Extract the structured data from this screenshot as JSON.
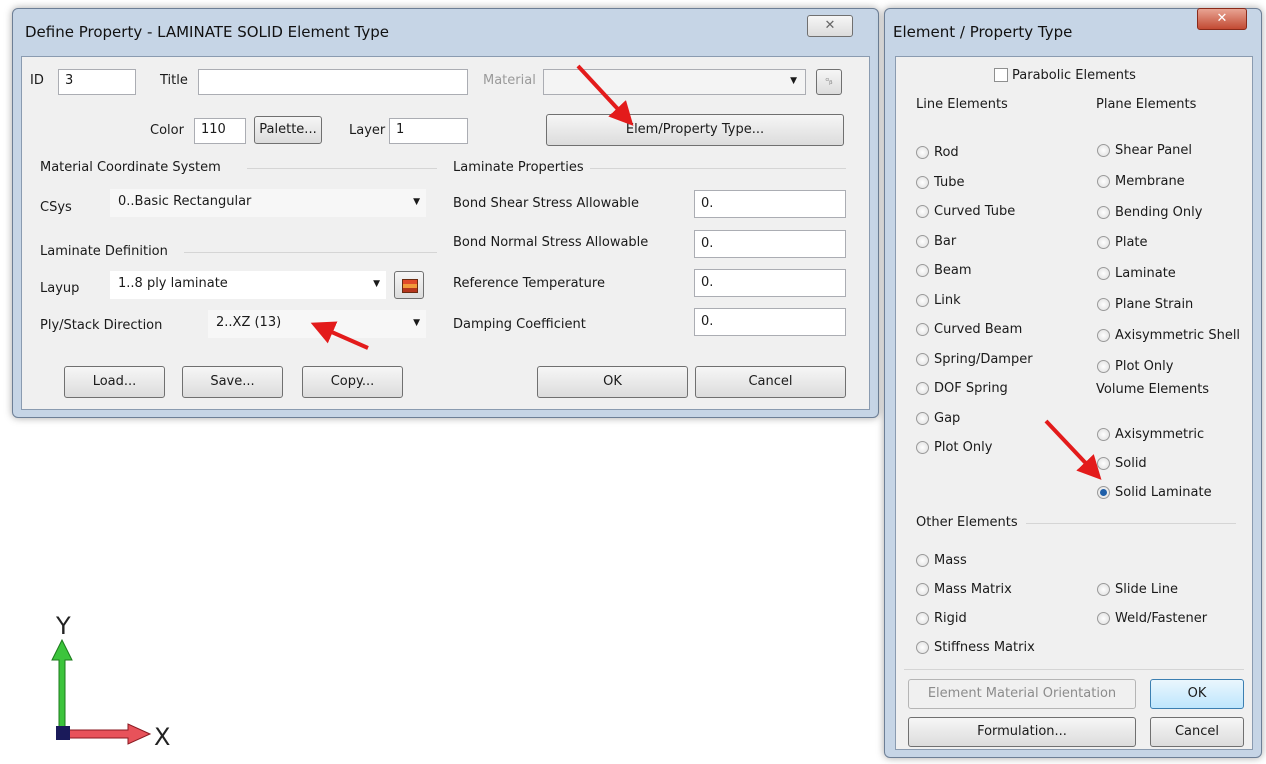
{
  "define_dialog": {
    "title": "Define Property - LAMINATE SOLID Element Type",
    "close_glyph": "✕",
    "id_label": "ID",
    "id_value": "3",
    "title_label": "Title",
    "title_value": "",
    "material_label": "Material",
    "material_value": "",
    "color_label": "Color",
    "color_value": "110",
    "palette_button": "Palette...",
    "layer_label": "Layer",
    "layer_value": "1",
    "elem_property_button": "Elem/Property Type...",
    "mcs_group": "Material Coordinate System",
    "csys_label": "CSys",
    "csys_value": "0..Basic Rectangular",
    "laminate_def_group": "Laminate Definition",
    "layup_label": "Layup",
    "layup_value": "1..8 ply laminate",
    "ply_dir_label": "Ply/Stack Direction",
    "ply_dir_value": "2..XZ (13)",
    "laminate_props_group": "Laminate Properties",
    "props": [
      {
        "label": "Bond Shear Stress Allowable",
        "value": "0."
      },
      {
        "label": "Bond Normal Stress Allowable",
        "value": "0."
      },
      {
        "label": "Reference Temperature",
        "value": "0."
      },
      {
        "label": "Damping Coefficient",
        "value": "0."
      }
    ],
    "load_button": "Load...",
    "save_button": "Save...",
    "copy_button": "Copy...",
    "ok_button": "OK",
    "cancel_button": "Cancel"
  },
  "type_dialog": {
    "title": "Element / Property Type",
    "close_glyph": "✕",
    "parabolic_label": "Parabolic Elements",
    "line_group": "Line Elements",
    "line_items": [
      "Rod",
      "Tube",
      "Curved Tube",
      "Bar",
      "Beam",
      "Link",
      "Curved Beam",
      "Spring/Damper",
      "DOF Spring",
      "Gap",
      "Plot Only"
    ],
    "plane_group": "Plane Elements",
    "plane_items": [
      "Shear Panel",
      "Membrane",
      "Bending Only",
      "Plate",
      "Laminate",
      "Plane Strain",
      "Axisymmetric Shell",
      "Plot Only"
    ],
    "volume_group": "Volume Elements",
    "volume_items": [
      "Axisymmetric",
      "Solid",
      "Solid Laminate"
    ],
    "selected": "Solid Laminate",
    "other_group": "Other Elements",
    "other_left": [
      "Mass",
      "Mass Matrix",
      "Rigid",
      "Stiffness Matrix"
    ],
    "other_right": [
      "Slide Line",
      "Weld/Fastener"
    ],
    "orientation_button": "Element Material Orientation",
    "ok_button": "OK",
    "formulation_button": "Formulation...",
    "cancel_button": "Cancel"
  },
  "axis_triad": {
    "y_label": "Y",
    "x_label": "X"
  },
  "colors": {
    "arrow": "#e31b1b",
    "y_axis": "#3cc43c",
    "x_axis": "#e8525a",
    "selected_radio": "#1f5fa9"
  }
}
